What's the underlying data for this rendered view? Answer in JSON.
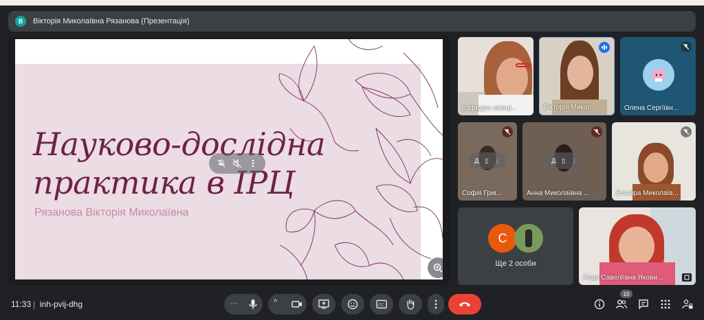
{
  "header": {
    "avatar_letter": "В",
    "title": "Вікторія Миколаївна Рязанова (Презентація)"
  },
  "slide": {
    "title_line1": "Науково-дослідна",
    "title_line2": "практика в ІРЦ",
    "subtitle": "Рязанова Вікторія Миколаївна"
  },
  "participants": [
    {
      "name": "Кафедра авіаці...",
      "state": "video"
    },
    {
      "name": "Вікторія Микол...",
      "state": "speaking"
    },
    {
      "name": "Олена Сергіївн...",
      "state": "muted"
    },
    {
      "name": "Софія Григ...",
      "state": "muted"
    },
    {
      "name": "Анна Миколаївна ...",
      "state": "muted"
    },
    {
      "name": "Ельвіра Миколаїв...",
      "state": "muted"
    },
    {
      "name": "Лада Савеліївна Якови...",
      "state": "video"
    }
  ],
  "others": {
    "label": "Ще 2 особи",
    "avatar_letter": "С"
  },
  "bottom": {
    "time": "11:33",
    "separator": "|",
    "meeting_code": "inh-pvij-dhg",
    "people_count": "10"
  },
  "colors": {
    "end_call": "#ea4335",
    "accent": "#1a73e8",
    "slide_text": "#6e2248"
  }
}
